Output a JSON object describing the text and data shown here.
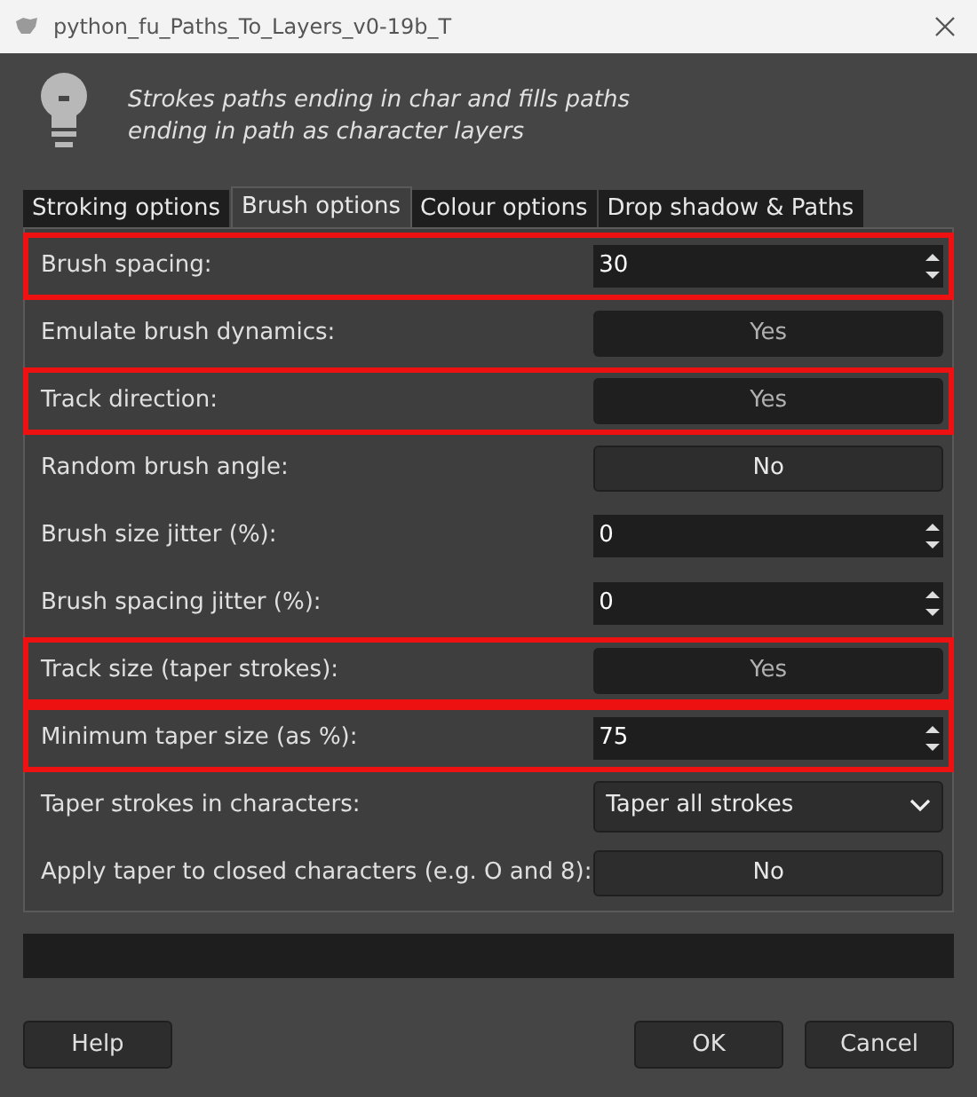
{
  "window": {
    "title": "python_fu_Paths_To_Layers_v0-19b_T"
  },
  "description": "Strokes paths ending in char and fills paths\nending in path as character layers",
  "tabs": [
    {
      "label": "Stroking options",
      "selected": false
    },
    {
      "label": "Brush options",
      "selected": true
    },
    {
      "label": "Colour options",
      "selected": false
    },
    {
      "label": "Drop shadow & Paths",
      "selected": false
    }
  ],
  "rows": [
    {
      "label": "Brush spacing:",
      "kind": "spin",
      "value": "30",
      "highlighted": true
    },
    {
      "label": "Emulate brush dynamics:",
      "kind": "toggle",
      "value": "Yes",
      "on": true,
      "highlighted": false
    },
    {
      "label": "Track direction:",
      "kind": "toggle",
      "value": "Yes",
      "on": true,
      "highlighted": true
    },
    {
      "label": "Random brush angle:",
      "kind": "toggle",
      "value": "No",
      "on": false,
      "highlighted": false
    },
    {
      "label": "Brush size jitter (%):",
      "kind": "spin",
      "value": "0",
      "highlighted": false
    },
    {
      "label": "Brush spacing jitter (%):",
      "kind": "spin",
      "value": "0",
      "highlighted": false
    },
    {
      "label": "Track size (taper strokes):",
      "kind": "toggle",
      "value": "Yes",
      "on": true,
      "highlighted": true
    },
    {
      "label": "Minimum taper size (as %):",
      "kind": "spin",
      "value": "75",
      "highlighted": true
    },
    {
      "label": "Taper strokes in characters:",
      "kind": "dropdown",
      "value": "Taper all strokes",
      "highlighted": false
    },
    {
      "label": "Apply taper to closed characters (e.g. O and 8):",
      "kind": "toggle",
      "value": "No",
      "on": false,
      "highlighted": false
    }
  ],
  "buttons": [
    {
      "label": "Help"
    },
    {
      "label": "OK"
    },
    {
      "label": "Cancel"
    }
  ]
}
